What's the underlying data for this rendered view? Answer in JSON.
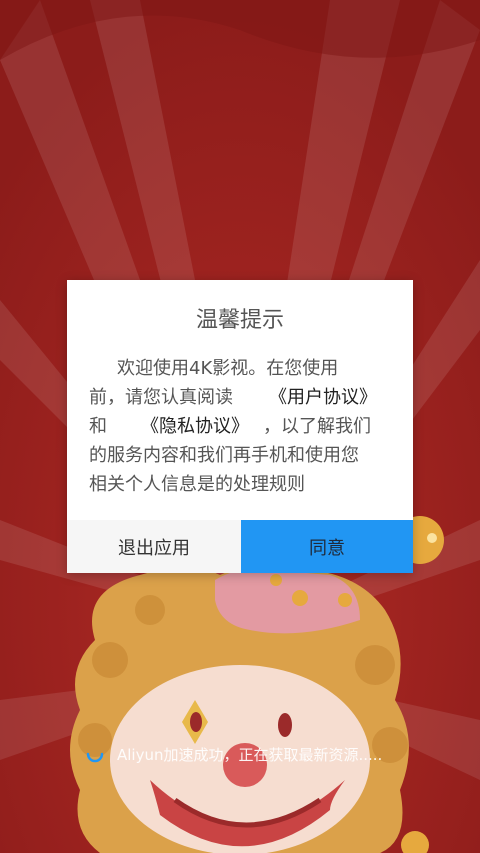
{
  "dialog": {
    "title": "温馨提示",
    "body": {
      "line1": "欢迎使用4K影视。在您使用",
      "line2_prefix": "前，请您认真阅读",
      "user_agreement_link": "《用户协议》",
      "line3_prefix": "和",
      "privacy_policy_link": "《隐私协议》",
      "line3_suffix": "，以了解我们",
      "line4": "的服务内容和我们再手机和使用您",
      "line5": "相关个人信息是的处理规则"
    },
    "exit_button": "退出应用",
    "agree_button": "同意"
  },
  "loading": {
    "text": "Aliyun加速成功，正在获取最新资源....."
  },
  "colors": {
    "background": "#951f1d",
    "agree_button": "#2196f3",
    "exit_button": "#f6f6f6",
    "clown_hair": "#dba14a",
    "clown_face": "#f6ddd0"
  },
  "icons": {
    "loading": "spinner-icon"
  }
}
